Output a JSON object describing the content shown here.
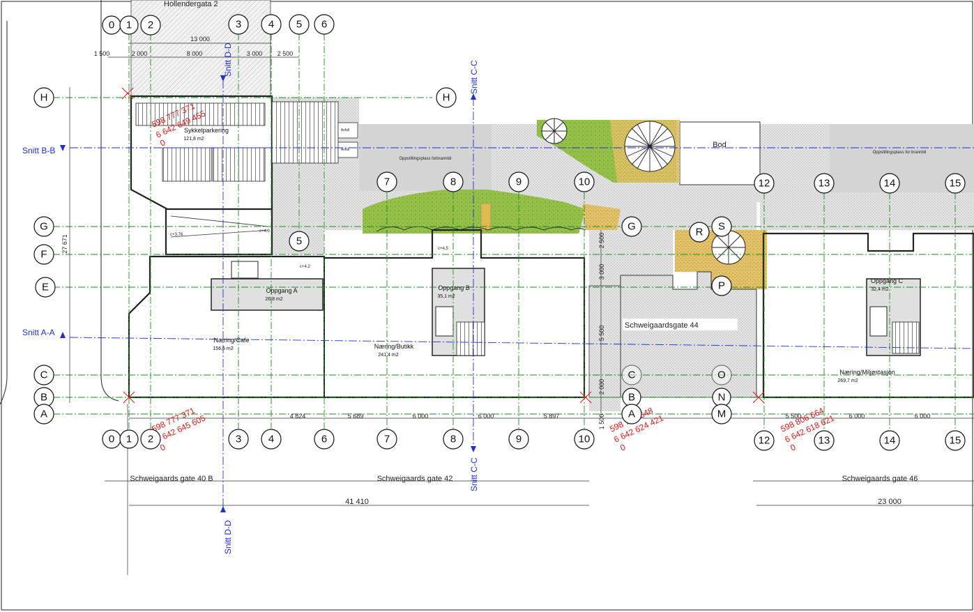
{
  "street_north": "Hollendergata 2",
  "grid_top": [
    "0",
    "1",
    "2",
    "3",
    "4",
    "5",
    "6"
  ],
  "grid_bottom": [
    "0",
    "1",
    "2",
    "3",
    "4",
    "6",
    "7",
    "8",
    "9",
    "10",
    "12",
    "13",
    "14",
    "15"
  ],
  "grid_mid": [
    "7",
    "8",
    "9",
    "10",
    "12",
    "13",
    "14",
    "15"
  ],
  "grid_left": [
    "H",
    "G",
    "F",
    "E",
    "C",
    "B",
    "A"
  ],
  "grid_other": {
    "H_right": "H",
    "G_right": "G",
    "five_a": "5",
    "five_b": "5",
    "R": "R",
    "S": "S",
    "P": "P",
    "B2": "B",
    "A2": "A",
    "C2": "C",
    "O": "O",
    "N": "N",
    "M": "M"
  },
  "sections": {
    "bb": "Snitt B-B",
    "aa": "Snitt A-A",
    "cc_top": "Snitt C-C",
    "cc_bottom": "Snitt C-C",
    "dd_top": "Snitt D-D",
    "dd_bottom": "Snitt D-D"
  },
  "dims_top": {
    "total": "13 000",
    "d1": "1 500",
    "d2": "2 000",
    "d3": "8 000",
    "d4": "3 000",
    "d5": "2 500"
  },
  "dims_bottom": {
    "a": "4 824",
    "b": "5 689",
    "c": "6 000",
    "d": "6 000",
    "e": "5 897",
    "f": "5 500",
    "g": "6 000",
    "h": "6 000",
    "v1": "1 500"
  },
  "dim_vertical": "27 671",
  "dims_mid": {
    "m1": "2 500",
    "m2": "3 000",
    "m3": "2 000",
    "m4": "5 500"
  },
  "street_labels": {
    "a": "Schweigaards gate 40 B",
    "b": "Schweigaards gate 42",
    "c": "Schweigaards gate 46"
  },
  "totals": {
    "left": "41 410",
    "right": "23 000"
  },
  "coords": {
    "c1a": "598 777 371",
    "c1b": "6 642 649 455",
    "c1c": "0",
    "c2a": "598 777 371",
    "c2b": "6 642 645 605",
    "c2c": "0",
    "c3a": "598 783 648",
    "c3b": "6 642 624 421",
    "c3c": "0",
    "c4a": "598 806 664",
    "c4b": "6 642 618 621",
    "c4c": "0"
  },
  "rooms": {
    "sykkel_name": "Sykkelparkering",
    "sykkel_area": "121,8 m2",
    "oppA_name": "Oppgang A",
    "oppA_area": "26,8 m2",
    "cafe_name": "Næring/Cafe",
    "cafe_area": "156,6 m2",
    "oppB_name": "Oppgang B",
    "oppB_area": "35,1 m2",
    "butikk_name": "Næring/Butikk",
    "butikk_area": "241,4 m2",
    "oppC_name": "Oppgang C",
    "oppC_area": "32,4 m2",
    "miljo_name": "Næring/Miljøstasjon",
    "miljo_area": "269,7 m2",
    "bod": "Bod",
    "gate44": "Schweigaardsgate 44",
    "brann1": "Oppstillingsplass forbrannbil",
    "brann2": "Oppstillingsplass for brannbil",
    "avfall1": "Avfall",
    "avfall2": "Avfall"
  },
  "levels": {
    "l1": "c+3,76",
    "l2": "c+4,0",
    "l3": "c+4,2",
    "l4": "c+4,5"
  },
  "colors": {
    "grid": "#1e8b1e",
    "section": "#1f2fd6",
    "coord": "#e01818",
    "grass": "#8db83a",
    "gravel": "#d9b25a",
    "paving": "#cfcfcf",
    "building": "#ececec"
  }
}
